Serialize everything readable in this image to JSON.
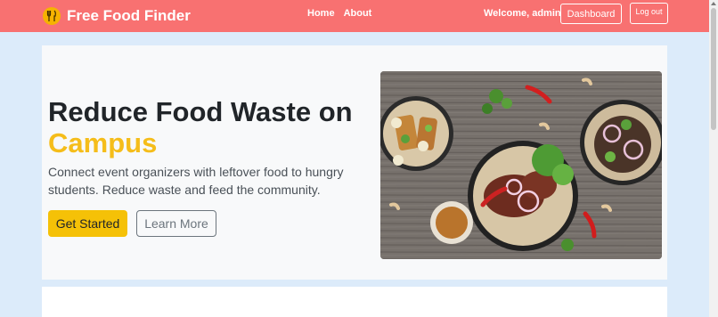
{
  "nav": {
    "brand": "Free Food Finder",
    "links": [
      "Home",
      "About"
    ],
    "welcome": "Welcome, admin",
    "dashboard": "Dashboard",
    "logout": "Log out"
  },
  "hero": {
    "title_line1": "Reduce Food Waste on",
    "title_line2": "Campus",
    "description": "Connect event organizers with leftover food to hungry students. Reduce waste and feed the community.",
    "primary_btn": "Get Started",
    "secondary_btn": "Learn More"
  },
  "colors": {
    "navbar": "#f87171",
    "accent": "#f5c107"
  }
}
